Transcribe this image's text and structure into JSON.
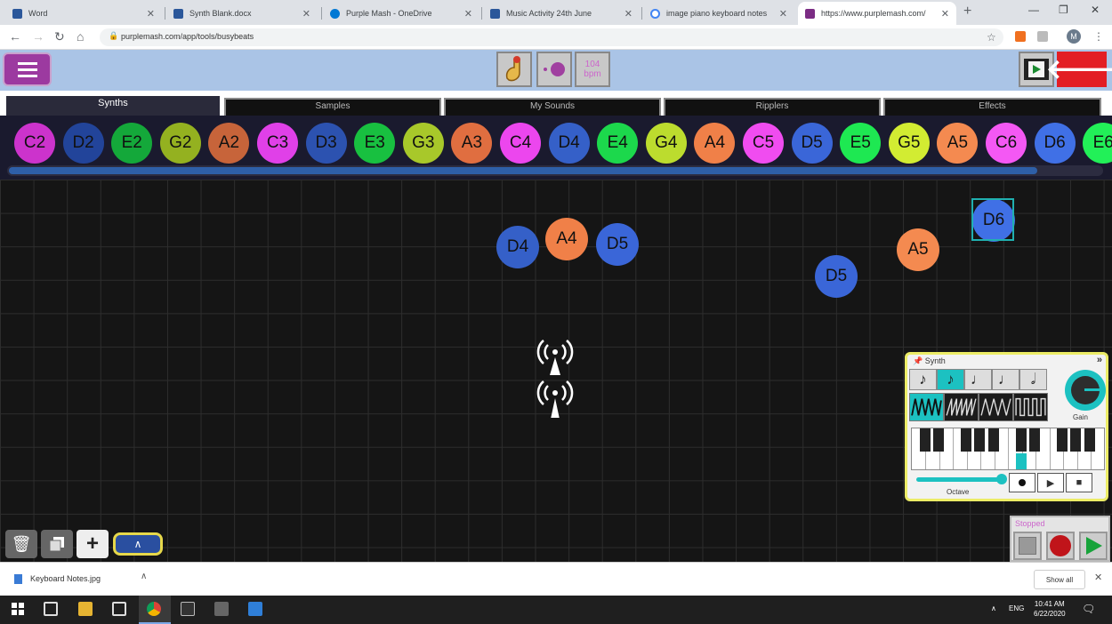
{
  "browser": {
    "tabs": [
      {
        "title": "Word",
        "favicon_color": "#2b579a"
      },
      {
        "title": "Synth Blank.docx",
        "favicon_color": "#2b579a"
      },
      {
        "title": "Purple Mash - OneDrive",
        "favicon_color": "#0078d4"
      },
      {
        "title": "Music Activity 24th June",
        "favicon_color": "#2b579a"
      },
      {
        "title": "image piano keyboard notes",
        "favicon_color": "#4285f4"
      },
      {
        "title": "https://www.purplemash.com/",
        "favicon_color": "#7b2c84"
      }
    ],
    "url": "purplemash.com/app/tools/busybeats",
    "profile_initial": "M"
  },
  "header": {
    "bpm_value": "104",
    "bpm_unit": "bpm"
  },
  "category_tabs": [
    "Synths",
    "Samples",
    "My Sounds",
    "Ripplers",
    "Effects"
  ],
  "palette_notes": [
    {
      "label": "C2",
      "color": "#cc33cc"
    },
    {
      "label": "D2",
      "color": "#22449a"
    },
    {
      "label": "E2",
      "color": "#14a83a"
    },
    {
      "label": "G2",
      "color": "#94b120"
    },
    {
      "label": "A2",
      "color": "#c7643a"
    },
    {
      "label": "C3",
      "color": "#e040e8"
    },
    {
      "label": "D3",
      "color": "#2c52b0"
    },
    {
      "label": "E3",
      "color": "#18c040"
    },
    {
      "label": "G3",
      "color": "#a8c82a"
    },
    {
      "label": "A3",
      "color": "#e06e40"
    },
    {
      "label": "C4",
      "color": "#ec46ee"
    },
    {
      "label": "D4",
      "color": "#3560c8"
    },
    {
      "label": "E4",
      "color": "#1cd84c"
    },
    {
      "label": "G4",
      "color": "#bcdc2e"
    },
    {
      "label": "A4",
      "color": "#f08048"
    },
    {
      "label": "C5",
      "color": "#f04cf0"
    },
    {
      "label": "D5",
      "color": "#3a66d8"
    },
    {
      "label": "E5",
      "color": "#1ee852"
    },
    {
      "label": "G5",
      "color": "#d2ec32"
    },
    {
      "label": "A5",
      "color": "#f48a50"
    },
    {
      "label": "C6",
      "color": "#f458f4"
    },
    {
      "label": "D6",
      "color": "#4070e6"
    },
    {
      "label": "E6",
      "color": "#22f058"
    }
  ],
  "placed_notes": [
    {
      "label": "D4",
      "color": "#3560c8"
    },
    {
      "label": "A4",
      "color": "#f08048"
    },
    {
      "label": "D5",
      "color": "#3a66d8"
    },
    {
      "label": "D5",
      "color": "#3a66d8"
    },
    {
      "label": "A5",
      "color": "#f48a50"
    },
    {
      "label": "D6",
      "color": "#4070e6"
    }
  ],
  "synth_panel": {
    "title": "Synth",
    "gain_label": "Gain",
    "octave_label": "Octave",
    "note_lengths": [
      "♪",
      "♪",
      "♩",
      "♩",
      "𝅗𝅥"
    ],
    "selected_length_index": 1
  },
  "playback": {
    "status": "Stopped"
  },
  "downloads": {
    "file": "Keyboard Notes.jpg",
    "show_all": "Show all"
  },
  "taskbar": {
    "language": "ENG",
    "time": "10:41 AM",
    "date": "6/22/2020"
  },
  "colors": {
    "accent_teal": "#1cc1c1",
    "menu_purple": "#9c3aa0",
    "back_red": "#e31e24"
  }
}
